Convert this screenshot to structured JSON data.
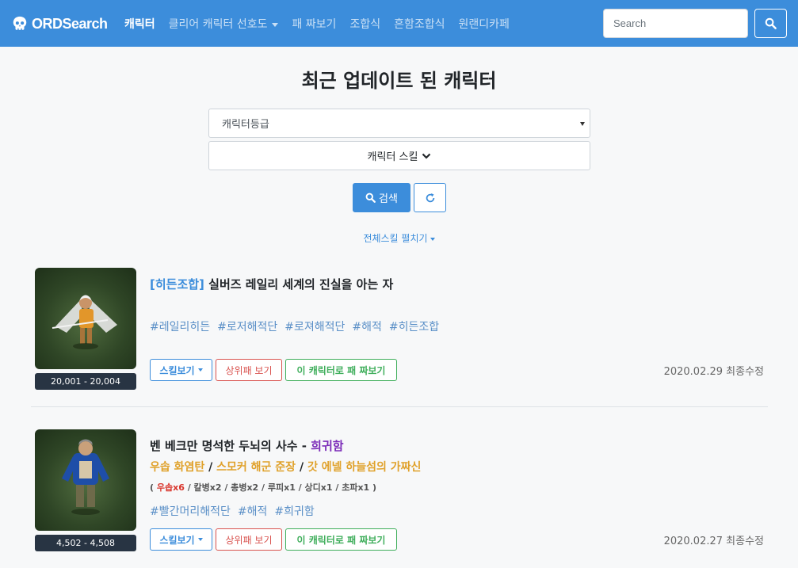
{
  "nav": {
    "brand": "ORDSearch",
    "links": [
      {
        "label": "캐릭터",
        "active": true
      },
      {
        "label": "클리어 캐릭터 선호도",
        "dropdown": true
      },
      {
        "label": "패 짜보기"
      },
      {
        "label": "조합식"
      },
      {
        "label": "흔함조합식"
      },
      {
        "label": "원랜디카페"
      }
    ],
    "search_placeholder": "Search",
    "colors": {
      "bar": "#3c8ddb"
    }
  },
  "main": {
    "title": "최근 업데이트 된 캐릭터",
    "grade_select": "캐릭터등급",
    "skill_toggle": "캐릭터 스킬",
    "search_button": "검색",
    "expand_all": "전체스킬 펼치기"
  },
  "characters": [
    {
      "prefix": "[히든조합]",
      "name": "실버즈 레일리 세계의 진실을 아는 자",
      "tags": [
        "#레일리히든",
        "#로저해적단",
        "#로져해적단",
        "#해적",
        "#히든조합"
      ],
      "range": "20,001 - 20,004",
      "skill_btn": "스킬보기",
      "upper_btn": "상위패 보기",
      "deck_btn": "이 캐릭터로 패 짜보기",
      "modified": "2020.02.29 최종수정"
    },
    {
      "name": "벤 베크만 명석한 두뇌의 사수",
      "separator": " - ",
      "rarity": "희귀함",
      "recipe": [
        "우솝 화염탄",
        "스모커 해군 준장",
        "갓 에넬 하늘섬의 가짜신"
      ],
      "ingredients": {
        "open": "( ",
        "highlight": "우솝x6",
        "rest": " / 칼병x2 / 총병x2 / 루피x1 / 상디x1 / 초파x1 )"
      },
      "tags": [
        "#빨간머리해적단",
        "#해적",
        "#희귀함"
      ],
      "range": "4,502 - 4,508",
      "skill_btn": "스킬보기",
      "upper_btn": "상위패 보기",
      "deck_btn": "이 캐릭터로 패 짜보기",
      "modified": "2020.02.27 최종수정"
    }
  ]
}
